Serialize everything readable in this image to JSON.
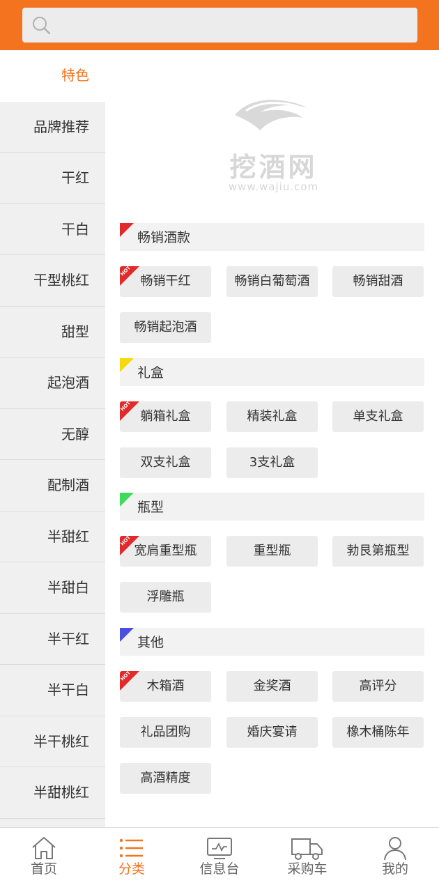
{
  "search": {
    "placeholder": ""
  },
  "sidebar": {
    "items": [
      {
        "label": "特色"
      },
      {
        "label": "品牌推荐"
      },
      {
        "label": "干红"
      },
      {
        "label": "干白"
      },
      {
        "label": "干型桃红"
      },
      {
        "label": "甜型"
      },
      {
        "label": "起泡酒"
      },
      {
        "label": "无醇"
      },
      {
        "label": "配制酒"
      },
      {
        "label": "半甜红"
      },
      {
        "label": "半甜白"
      },
      {
        "label": "半干红"
      },
      {
        "label": "半干白"
      },
      {
        "label": "半干桃红"
      },
      {
        "label": "半甜桃红"
      }
    ]
  },
  "logo": {
    "cn": "挖酒网",
    "en": "www.wajiu.com"
  },
  "sections": [
    {
      "title": "畅销酒款",
      "color": "#e22a2a",
      "tags": [
        "畅销干红",
        "畅销白葡萄酒",
        "畅销甜酒",
        "畅销起泡酒"
      ]
    },
    {
      "title": "礼盒",
      "color": "#f5d90c",
      "tags": [
        "躺箱礼盒",
        "精装礼盒",
        "单支礼盒",
        "双支礼盒",
        "3支礼盒"
      ]
    },
    {
      "title": "瓶型",
      "color": "#3ddb5a",
      "tags": [
        "宽肩重型瓶",
        "重型瓶",
        "勃艮第瓶型",
        "浮雕瓶"
      ]
    },
    {
      "title": "其他",
      "color": "#4a4fe0",
      "tags": [
        "木箱酒",
        "金奖酒",
        "高评分",
        "礼品团购",
        "婚庆宴请",
        "橡木桶陈年",
        "高酒精度"
      ]
    }
  ],
  "hot_badge": "HOT",
  "tabbar": {
    "items": [
      {
        "label": "首页",
        "icon": "home-icon"
      },
      {
        "label": "分类",
        "icon": "list-icon"
      },
      {
        "label": "信息台",
        "icon": "monitor-icon"
      },
      {
        "label": "采购车",
        "icon": "truck-icon"
      },
      {
        "label": "我的",
        "icon": "user-icon"
      }
    ],
    "active_color": "#f4731f"
  },
  "colors": {
    "brand": "#f4731f",
    "hot": "#e22a2a"
  }
}
